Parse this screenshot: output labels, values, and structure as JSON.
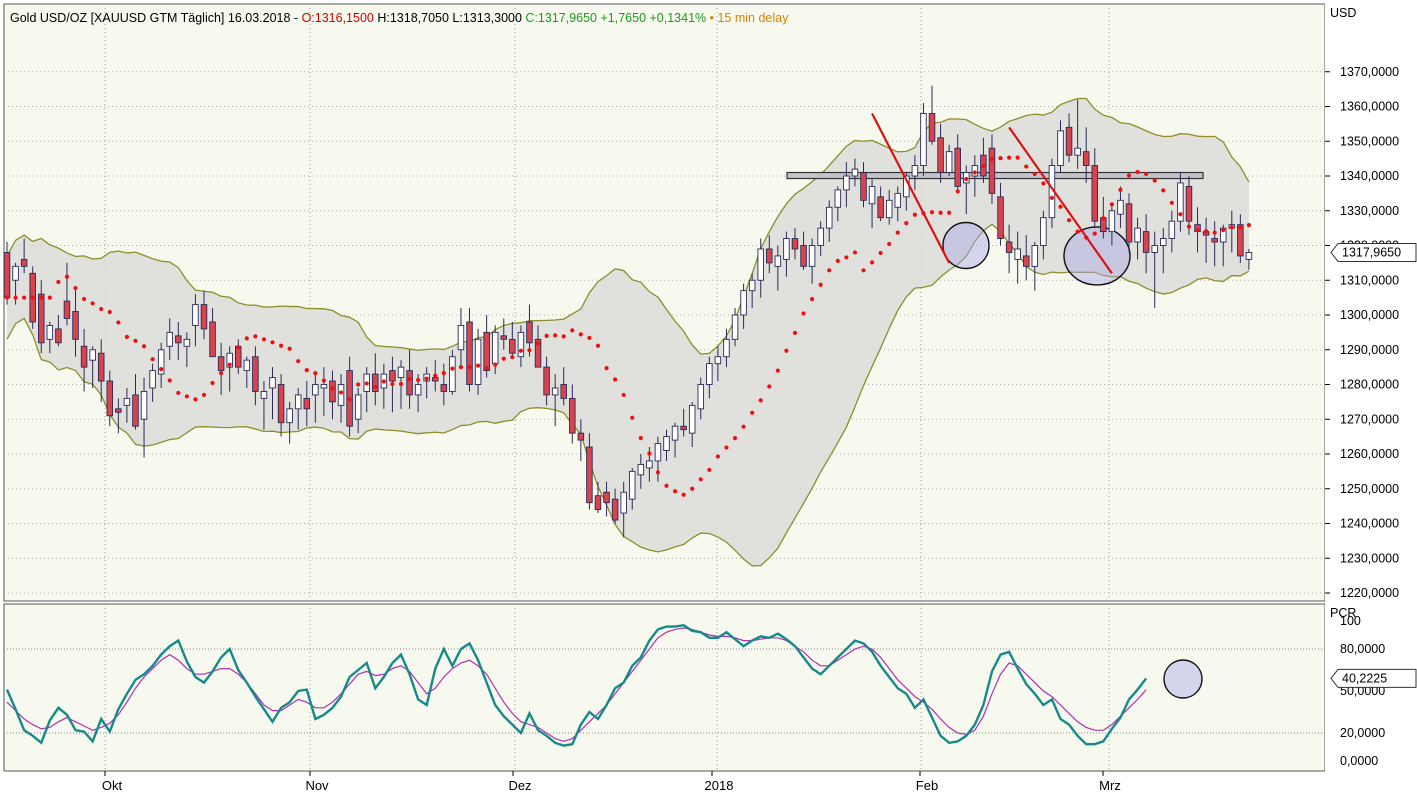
{
  "header": {
    "instrument": "Gold USD/OZ [XAUUSD GTM Täglich] 16.03.2018 -",
    "open": "O:1316,1500",
    "high": "H:1318,7050",
    "low": "L:1313,3000",
    "close": "C:1317,9650 +1,7650 +0,1341%",
    "delay": "• 15 min delay"
  },
  "colors": {
    "background": "#f8f9ee",
    "band_fill": "#dcdcd8",
    "band_line": "#8b8f2a",
    "candle_up": "#ffffff",
    "candle_down": "#d9444c",
    "candle_outline": "#2a2a5a",
    "sar_dots": "#ee1111",
    "trendline": "#dd1111",
    "pcr_line": "#158a8a",
    "pcr_signal": "#b030b0",
    "circle_fill": "#a8a8e8"
  },
  "price_panel": {
    "unit_label": "USD",
    "last_price_label": "1317,9650",
    "ytick_labels": [
      "1370,0000",
      "1360,0000",
      "1350,0000",
      "1340,0000",
      "1330,0000",
      "1320,0000",
      "1310,0000",
      "1300,0000",
      "1290,0000",
      "1280,0000",
      "1270,0000",
      "1260,0000",
      "1250,0000",
      "1240,0000",
      "1230,0000",
      "1220,0000"
    ]
  },
  "pcr_panel": {
    "label": "PCR",
    "ytick_labels": [
      "100",
      "80,0000",
      "50,0000",
      "20,0000",
      "0,0000"
    ],
    "last_value_label": "40,2225"
  },
  "x_axis": {
    "labels": [
      "Okt",
      "Nov",
      "Dez",
      "2018",
      "Feb",
      "Mrz"
    ]
  },
  "chart_data": {
    "type": "candlestick",
    "instrument": "Gold USD/OZ",
    "ylim": [
      1215,
      1375
    ],
    "ohlc": [
      [
        1318,
        1321,
        1303,
        1305
      ],
      [
        1310,
        1315,
        1303,
        1314
      ],
      [
        1316,
        1322,
        1312,
        1314
      ],
      [
        1312,
        1314,
        1296,
        1298
      ],
      [
        1306,
        1310,
        1289,
        1292
      ],
      [
        1293,
        1298,
        1289,
        1297
      ],
      [
        1296,
        1300,
        1291,
        1292
      ],
      [
        1304,
        1315,
        1297,
        1299
      ],
      [
        1301,
        1308,
        1288,
        1293
      ],
      [
        1291,
        1296,
        1278,
        1285
      ],
      [
        1287,
        1291,
        1279,
        1290
      ],
      [
        1289,
        1293,
        1275,
        1281
      ],
      [
        1281,
        1284,
        1268,
        1271
      ],
      [
        1273,
        1276,
        1266,
        1272
      ],
      [
        1274,
        1279,
        1269,
        1276
      ],
      [
        1277,
        1283,
        1267,
        1268
      ],
      [
        1270,
        1282,
        1259,
        1278
      ],
      [
        1279,
        1286,
        1275,
        1284
      ],
      [
        1283,
        1292,
        1279,
        1290
      ],
      [
        1291,
        1299,
        1287,
        1295
      ],
      [
        1294,
        1298,
        1287,
        1292
      ],
      [
        1291,
        1295,
        1285,
        1293
      ],
      [
        1297,
        1306,
        1291,
        1303
      ],
      [
        1303,
        1307,
        1293,
        1296
      ],
      [
        1298,
        1302,
        1290,
        1288
      ],
      [
        1288,
        1292,
        1277,
        1284
      ],
      [
        1285,
        1291,
        1278,
        1289
      ],
      [
        1291,
        1293,
        1283,
        1285
      ],
      [
        1284,
        1288,
        1279,
        1287
      ],
      [
        1288,
        1291,
        1274,
        1278
      ],
      [
        1276,
        1281,
        1267,
        1278
      ],
      [
        1279,
        1285,
        1270,
        1282
      ],
      [
        1280,
        1283,
        1265,
        1269
      ],
      [
        1269,
        1275,
        1263,
        1273
      ],
      [
        1273,
        1279,
        1267,
        1277
      ],
      [
        1276,
        1281,
        1268,
        1273
      ],
      [
        1277,
        1283,
        1269,
        1280
      ],
      [
        1279,
        1285,
        1271,
        1280
      ],
      [
        1281,
        1284,
        1270,
        1275
      ],
      [
        1274,
        1283,
        1269,
        1280
      ],
      [
        1284,
        1288,
        1265,
        1268
      ],
      [
        1270,
        1279,
        1266,
        1277
      ],
      [
        1278,
        1285,
        1272,
        1283
      ],
      [
        1283,
        1289,
        1274,
        1278
      ],
      [
        1279,
        1286,
        1273,
        1283
      ],
      [
        1284,
        1288,
        1272,
        1281
      ],
      [
        1282,
        1287,
        1273,
        1285
      ],
      [
        1284,
        1290,
        1273,
        1277
      ],
      [
        1277,
        1283,
        1272,
        1280
      ],
      [
        1281,
        1285,
        1276,
        1283
      ],
      [
        1282,
        1287,
        1278,
        1281
      ],
      [
        1280,
        1286,
        1274,
        1278
      ],
      [
        1278,
        1290,
        1277,
        1288
      ],
      [
        1290,
        1302,
        1285,
        1297
      ],
      [
        1298,
        1302,
        1278,
        1280
      ],
      [
        1280,
        1296,
        1277,
        1293
      ],
      [
        1295,
        1300,
        1282,
        1284
      ],
      [
        1286,
        1297,
        1283,
        1295
      ],
      [
        1294,
        1299,
        1290,
        1293
      ],
      [
        1293,
        1298,
        1288,
        1289
      ],
      [
        1288,
        1297,
        1285,
        1295
      ],
      [
        1298,
        1303,
        1288,
        1292
      ],
      [
        1293,
        1297,
        1287,
        1285
      ],
      [
        1285,
        1288,
        1274,
        1277
      ],
      [
        1277,
        1283,
        1268,
        1279
      ],
      [
        1280,
        1285,
        1274,
        1276
      ],
      [
        1276,
        1280,
        1263,
        1266
      ],
      [
        1266,
        1270,
        1258,
        1264
      ],
      [
        1262,
        1266,
        1244,
        1246
      ],
      [
        1248,
        1252,
        1243,
        1244
      ],
      [
        1249,
        1252,
        1242,
        1246
      ],
      [
        1247,
        1250,
        1240,
        1241
      ],
      [
        1243,
        1252,
        1236,
        1249
      ],
      [
        1247,
        1256,
        1244,
        1255
      ],
      [
        1254,
        1260,
        1250,
        1257
      ],
      [
        1256,
        1262,
        1252,
        1258
      ],
      [
        1258,
        1265,
        1252,
        1263
      ],
      [
        1261,
        1267,
        1258,
        1265
      ],
      [
        1264,
        1269,
        1259,
        1268
      ],
      [
        1268,
        1273,
        1265,
        1267
      ],
      [
        1266,
        1275,
        1262,
        1274
      ],
      [
        1273,
        1282,
        1270,
        1280
      ],
      [
        1280,
        1288,
        1276,
        1286
      ],
      [
        1286,
        1291,
        1281,
        1288
      ],
      [
        1288,
        1296,
        1285,
        1293
      ],
      [
        1293,
        1302,
        1291,
        1300
      ],
      [
        1300,
        1309,
        1296,
        1307
      ],
      [
        1307,
        1312,
        1302,
        1310
      ],
      [
        1310,
        1322,
        1305,
        1319
      ],
      [
        1319,
        1323,
        1312,
        1315
      ],
      [
        1314,
        1320,
        1307,
        1317
      ],
      [
        1316,
        1324,
        1311,
        1322
      ],
      [
        1322,
        1325,
        1316,
        1319
      ],
      [
        1320,
        1324,
        1313,
        1314
      ],
      [
        1314,
        1322,
        1309,
        1320
      ],
      [
        1320,
        1327,
        1317,
        1325
      ],
      [
        1325,
        1333,
        1321,
        1331
      ],
      [
        1331,
        1337,
        1327,
        1336
      ],
      [
        1336,
        1344,
        1331,
        1340
      ],
      [
        1340,
        1345,
        1337,
        1342
      ],
      [
        1341,
        1344,
        1331,
        1333
      ],
      [
        1332,
        1339,
        1325,
        1337
      ],
      [
        1334,
        1337,
        1327,
        1328
      ],
      [
        1328,
        1336,
        1326,
        1333
      ],
      [
        1331,
        1337,
        1327,
        1335
      ],
      [
        1334,
        1341,
        1330,
        1340
      ],
      [
        1340,
        1346,
        1336,
        1343
      ],
      [
        1343,
        1361,
        1340,
        1358
      ],
      [
        1358,
        1366,
        1349,
        1350
      ],
      [
        1351,
        1355,
        1338,
        1341
      ],
      [
        1341,
        1349,
        1340,
        1347
      ],
      [
        1348,
        1352,
        1335,
        1337
      ],
      [
        1338,
        1343,
        1329,
        1341
      ],
      [
        1340,
        1346,
        1334,
        1343
      ],
      [
        1346,
        1351,
        1338,
        1340
      ],
      [
        1348,
        1352,
        1332,
        1335
      ],
      [
        1334,
        1338,
        1320,
        1322
      ],
      [
        1321,
        1326,
        1312,
        1318
      ],
      [
        1316,
        1324,
        1309,
        1319
      ],
      [
        1317,
        1323,
        1310,
        1314
      ],
      [
        1314,
        1321,
        1307,
        1320
      ],
      [
        1320,
        1330,
        1316,
        1328
      ],
      [
        1328,
        1345,
        1325,
        1343
      ],
      [
        1343,
        1356,
        1341,
        1353
      ],
      [
        1354,
        1358,
        1344,
        1346
      ],
      [
        1346,
        1362,
        1342,
        1348
      ],
      [
        1347,
        1354,
        1338,
        1343
      ],
      [
        1343,
        1348,
        1325,
        1327
      ],
      [
        1328,
        1334,
        1322,
        1324
      ],
      [
        1324,
        1332,
        1320,
        1330
      ],
      [
        1329,
        1337,
        1325,
        1333
      ],
      [
        1332,
        1335,
        1318,
        1321
      ],
      [
        1321,
        1328,
        1316,
        1325
      ],
      [
        1324,
        1329,
        1312,
        1318
      ],
      [
        1318,
        1324,
        1302,
        1320
      ],
      [
        1320,
        1325,
        1312,
        1322
      ],
      [
        1322,
        1330,
        1318,
        1327
      ],
      [
        1327,
        1341,
        1324,
        1338
      ],
      [
        1337,
        1340,
        1323,
        1327
      ],
      [
        1326,
        1331,
        1318,
        1324
      ],
      [
        1324,
        1328,
        1315,
        1323
      ],
      [
        1322,
        1327,
        1314,
        1321
      ],
      [
        1321,
        1326,
        1314,
        1325
      ],
      [
        1325,
        1330,
        1318,
        1326
      ],
      [
        1326,
        1329,
        1315,
        1317
      ],
      [
        1316,
        1319,
        1313,
        1318
      ]
    ],
    "pcr": [
      51,
      37,
      22,
      18,
      13,
      29,
      38,
      33,
      22,
      21,
      14,
      30,
      21,
      37,
      48,
      58,
      62,
      68,
      76,
      82,
      86,
      71,
      60,
      56,
      64,
      74,
      80,
      65,
      56,
      46,
      37,
      28,
      38,
      42,
      50,
      51,
      30,
      33,
      38,
      46,
      60,
      65,
      70,
      52,
      60,
      70,
      76,
      62,
      44,
      40,
      66,
      80,
      68,
      80,
      84,
      72,
      56,
      40,
      32,
      26,
      20,
      34,
      22,
      18,
      13,
      11,
      12,
      26,
      35,
      30,
      40,
      52,
      56,
      68,
      74,
      86,
      94,
      96,
      96,
      97,
      93,
      92,
      88,
      88,
      92,
      87,
      82,
      86,
      89,
      88,
      91,
      87,
      82,
      74,
      66,
      62,
      68,
      74,
      80,
      86,
      84,
      78,
      68,
      60,
      52,
      48,
      38,
      44,
      31,
      18,
      13,
      14,
      18,
      26,
      40,
      64,
      76,
      78,
      66,
      55,
      48,
      40,
      44,
      30,
      26,
      18,
      12,
      12,
      14,
      23,
      31,
      44,
      51,
      59
    ],
    "pcr_signal_values": [
      42,
      36,
      30,
      26,
      23,
      24,
      28,
      31,
      28,
      25,
      22,
      24,
      27,
      33,
      42,
      52,
      60,
      66,
      72,
      76,
      72,
      66,
      62,
      62,
      64,
      66,
      66,
      62,
      56,
      48,
      40,
      36,
      36,
      40,
      44,
      42,
      38,
      38,
      42,
      48,
      55,
      62,
      64,
      61,
      62,
      66,
      68,
      64,
      56,
      48,
      52,
      60,
      66,
      70,
      72,
      68,
      62,
      52,
      42,
      34,
      28,
      26,
      24,
      20,
      16,
      14,
      16,
      22,
      28,
      34,
      40,
      48,
      56,
      64,
      72,
      80,
      88,
      92,
      94,
      95,
      94,
      92,
      90,
      89,
      89,
      88,
      86,
      86,
      87,
      88,
      88,
      86,
      82,
      78,
      72,
      68,
      68,
      72,
      76,
      80,
      82,
      80,
      74,
      66,
      58,
      52,
      46,
      42,
      37,
      30,
      24,
      20,
      19,
      22,
      32,
      48,
      62,
      70,
      68,
      62,
      56,
      50,
      46,
      40,
      34,
      28,
      24,
      22,
      22,
      26,
      32,
      38,
      44,
      51
    ],
    "pcr_ylim": [
      -3,
      115
    ],
    "bollinger_bands": "20-period upper / middle / lower",
    "parabolic_sar": "dots",
    "annotations": [
      "horizontal resistance box ~1340",
      "descending red trendlines from 1358 and 1354",
      "highlight circles at 1320 and 1317 area",
      "circle on PCR at end"
    ]
  }
}
